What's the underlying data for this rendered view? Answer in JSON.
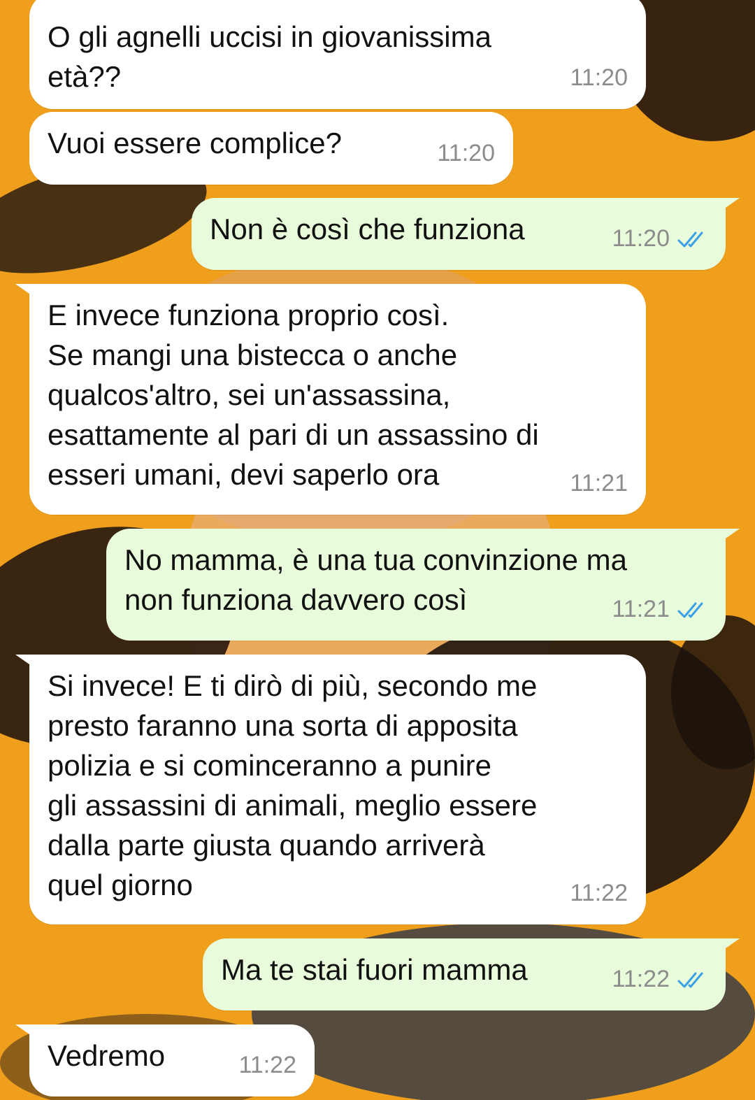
{
  "messages": [
    {
      "id": "m1",
      "side": "incoming",
      "text": "O gli agnelli uccisi in giovanissima\netà??",
      "time": "11:20"
    },
    {
      "id": "m2",
      "side": "incoming",
      "text": "Vuoi essere complice?",
      "time": "11:20"
    },
    {
      "id": "m3",
      "side": "outgoing",
      "text": "Non è così che funziona",
      "time": "11:20",
      "read": true
    },
    {
      "id": "m4",
      "side": "incoming",
      "text": "E invece funziona proprio così.\nSe mangi una bistecca o anche\nqualcos'altro, sei un'assassina,\nesattamente al pari di un assassino di\nesseri umani, devi saperlo ora",
      "time": "11:21"
    },
    {
      "id": "m5",
      "side": "outgoing",
      "text": "No mamma, è una tua convinzione ma\nnon funziona davvero così",
      "time": "11:21",
      "read": true
    },
    {
      "id": "m6",
      "side": "incoming",
      "text": "Si invece! E ti dirò di più, secondo me\npresto faranno una sorta di apposita\npolizia e si cominceranno a punire\ngli assassini di animali, meglio essere\ndalla parte giusta quando arriverà\nquel giorno",
      "time": "11:22"
    },
    {
      "id": "m7",
      "side": "outgoing",
      "text": "Ma te stai fuori mamma",
      "time": "11:22",
      "read": true
    },
    {
      "id": "m8",
      "side": "incoming",
      "text": "Vedremo",
      "time": "11:22"
    }
  ],
  "colors": {
    "wallpaper": "#ef9f1c",
    "incoming_bubble": "#ffffff",
    "outgoing_bubble": "#e8fbda",
    "timestamp": "#8c8c8c",
    "read_ticks": "#3aa0e8"
  },
  "icons": {
    "read_receipt": "double-check-icon"
  }
}
